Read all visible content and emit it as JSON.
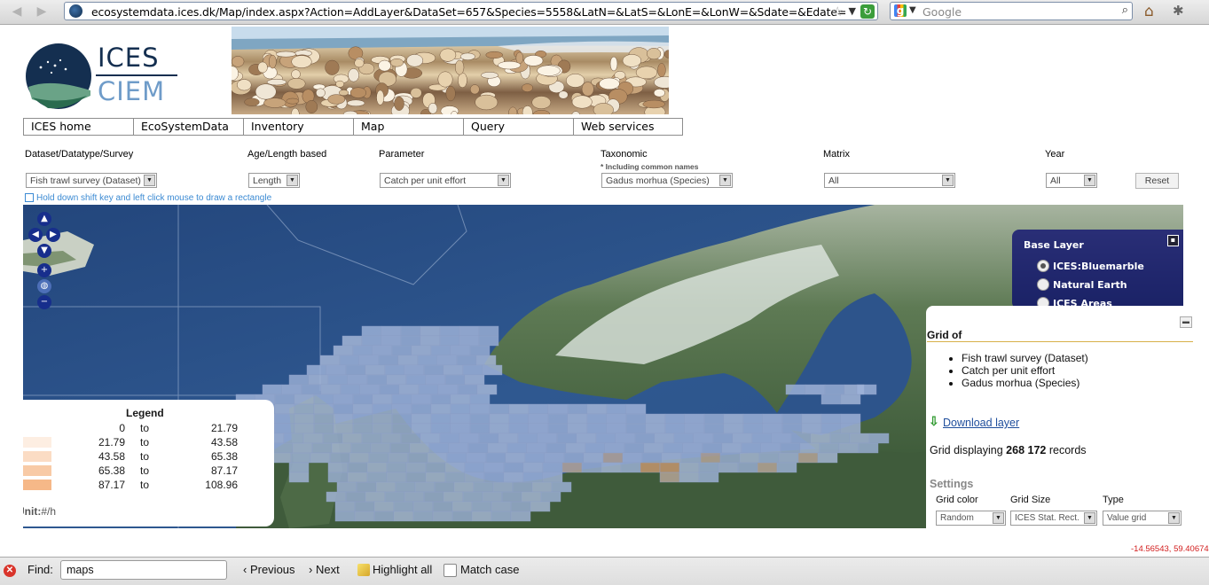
{
  "browser": {
    "url": "ecosystemdata.ices.dk/Map/index.aspx?Action=AddLayer&DataSet=657&Species=5558&LatN=&LatS=&LonE=&LonW=&Sdate=&Edate=",
    "search_placeholder": "Google"
  },
  "logo": {
    "line1": "ICES",
    "line2": "CIEM"
  },
  "nav": [
    "ICES home",
    "EcoSystemData",
    "Inventory",
    "Map",
    "Query",
    "Web services"
  ],
  "filters": {
    "dataset": {
      "label": "Dataset/Datatype/Survey",
      "value": "Fish trawl survey (Dataset)"
    },
    "agelength": {
      "label": "Age/Length based",
      "value": "Length"
    },
    "parameter": {
      "label": "Parameter",
      "value": "Catch per unit effort"
    },
    "taxonomic": {
      "label": "Taxonomic",
      "note": "* Including common names",
      "value": "Gadus morhua (Species)"
    },
    "matrix": {
      "label": "Matrix",
      "value": "All"
    },
    "year": {
      "label": "Year",
      "value": "All"
    },
    "reset": "Reset",
    "hint": "Hold down shift key and left click mouse to draw a rectangle"
  },
  "baselayer": {
    "title": "Base Layer",
    "options": [
      "ICES:Bluemarble",
      "Natural Earth",
      "ICES Areas"
    ],
    "selected": 0
  },
  "legend": {
    "title": "Legend",
    "rows": [
      {
        "from": "0",
        "to_word": "to",
        "to": "21.79",
        "color": "#ffffff"
      },
      {
        "from": "21.79",
        "to_word": "to",
        "to": "43.58",
        "color": "#fdeee2"
      },
      {
        "from": "43.58",
        "to_word": "to",
        "to": "65.38",
        "color": "#fbdcc4"
      },
      {
        "from": "65.38",
        "to_word": "to",
        "to": "87.17",
        "color": "#f8caa6"
      },
      {
        "from": "87.17",
        "to_word": "to",
        "to": "108.96",
        "color": "#f6b888"
      }
    ],
    "unit_label": "Unit:",
    "unit_value": "#/h"
  },
  "info": {
    "title": "Grid of",
    "items": [
      "Fish trawl survey (Dataset)",
      "Catch per unit effort",
      "Gadus morhua (Species)"
    ],
    "download": "Download layer",
    "records_prefix": "Grid displaying",
    "records_count": "268 172",
    "records_suffix": "records",
    "settings": "Settings",
    "grid_color_label": "Grid color",
    "grid_color": "Random",
    "grid_size_label": "Grid Size",
    "grid_size": "ICES Stat. Rect.",
    "type_label": "Type",
    "type": "Value grid"
  },
  "coordinates": "-14.56543, 59.40674",
  "findbar": {
    "label": "Find:",
    "query": "maps",
    "previous": "Previous",
    "next": "Next",
    "highlight": "Highlight all",
    "match_case": "Match case"
  }
}
